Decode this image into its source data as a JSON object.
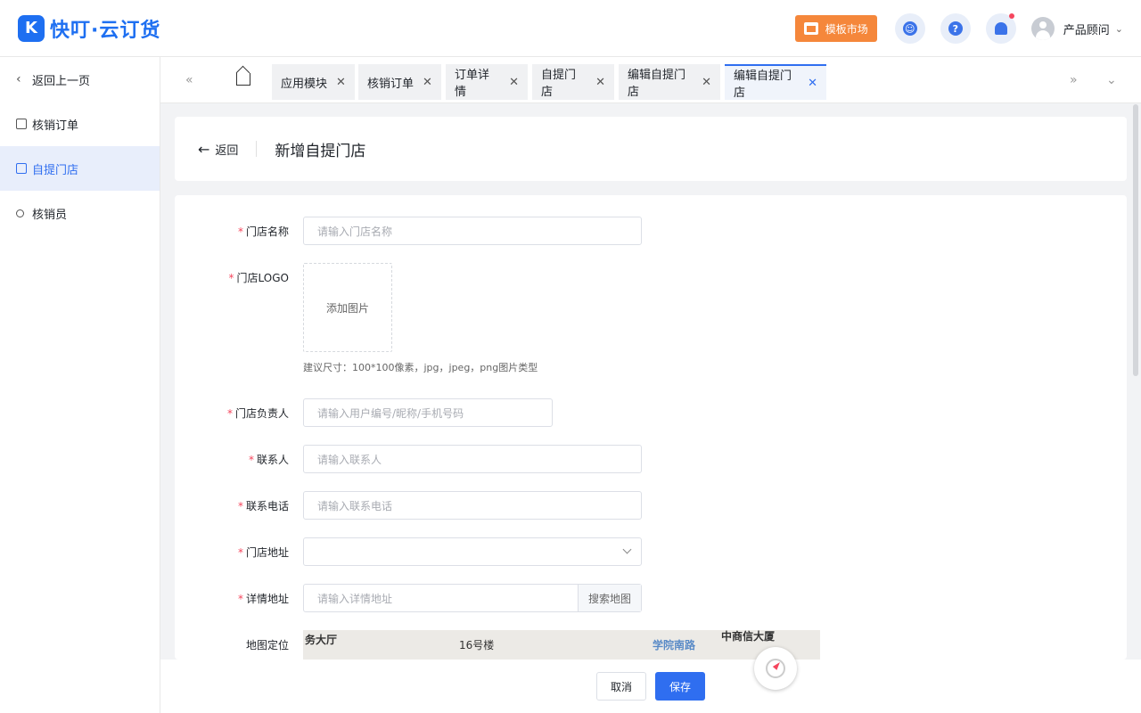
{
  "header": {
    "logo_text": "快叮·云订货",
    "logo_mark": "K",
    "market_label": "模板市场",
    "user_name": "产品顾问",
    "icons": [
      "service-icon",
      "help-icon",
      "bell-icon"
    ]
  },
  "sidebar": {
    "back_label": "返回上一页",
    "items": [
      {
        "label": "核销订单"
      },
      {
        "label": "自提门店"
      },
      {
        "label": "核销员"
      }
    ]
  },
  "tabs": {
    "items": [
      {
        "label": "应用模块"
      },
      {
        "label": "核销订单"
      },
      {
        "label": "订单详情"
      },
      {
        "label": "自提门店"
      },
      {
        "label": "编辑自提门店"
      },
      {
        "label": "编辑自提门店"
      }
    ],
    "active_index": 5
  },
  "page": {
    "back_label": "返回",
    "title": "新增自提门店"
  },
  "form": {
    "store_name": {
      "label": "门店名称",
      "placeholder": "请输入门店名称"
    },
    "store_logo": {
      "label": "门店LOGO",
      "upload_label": "添加图片",
      "hint": "建议尺寸：100*100像素，jpg，jpeg，png图片类型"
    },
    "manager": {
      "label": "门店负责人",
      "placeholder": "请输入用户编号/昵称/手机号码"
    },
    "contact": {
      "label": "联系人",
      "placeholder": "请输入联系人"
    },
    "phone": {
      "label": "联系电话",
      "placeholder": "请输入联系电话"
    },
    "address": {
      "label": "门店地址",
      "value": ""
    },
    "detail_address": {
      "label": "详情地址",
      "placeholder": "请输入详情地址",
      "search_label": "搜索地图"
    },
    "map": {
      "label": "地图定位",
      "places": [
        "务大厅",
        "16号楼",
        "学院南路",
        "中商信大厦"
      ]
    }
  },
  "footer": {
    "cancel_label": "取消",
    "save_label": "保存"
  },
  "colors": {
    "primary": "#2f6ef0",
    "accent_orange": "#f5873b",
    "required": "#f5465d"
  }
}
